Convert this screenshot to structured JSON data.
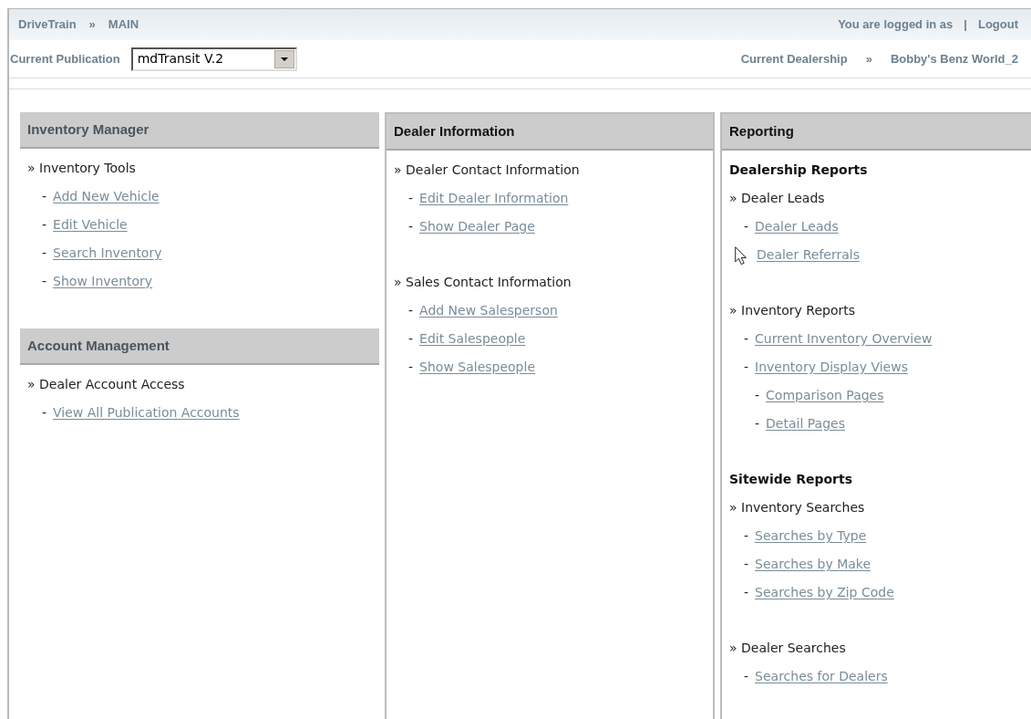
{
  "breadcrumb": [
    "DriveTrain",
    "»",
    "MAIN"
  ],
  "login_text": "You are logged in as",
  "login_separator": "|",
  "logout": "Logout",
  "publication": {
    "label": "Current Publication",
    "value": "mdTransit V.2"
  },
  "dealership": {
    "label": "Current Dealership",
    "separator": "»",
    "value": "Bobby's Benz World_2"
  },
  "columns": [
    {
      "panels": [
        {
          "title": "Inventory Manager",
          "blocks": [
            {
              "kind": "group",
              "label": "» Inventory Tools",
              "links": [
                {
                  "marker": "-",
                  "text": "Add New Vehicle"
                },
                {
                  "marker": "-",
                  "text": "Edit Vehicle"
                },
                {
                  "marker": "-",
                  "text": "Search Inventory"
                },
                {
                  "marker": "-",
                  "text": "Show Inventory"
                }
              ]
            }
          ]
        },
        {
          "title": "Account Management",
          "blocks": [
            {
              "kind": "group",
              "label": "» Dealer Account Access",
              "links": [
                {
                  "marker": "-",
                  "text": "View All Publication Accounts"
                }
              ]
            }
          ]
        }
      ]
    },
    {
      "panels": [
        {
          "title": "Dealer Information",
          "blocks": [
            {
              "kind": "group",
              "label": "» Dealer Contact Information",
              "links": [
                {
                  "marker": "-",
                  "text": "Edit Dealer Information"
                },
                {
                  "marker": "-",
                  "text": "Show Dealer Page"
                }
              ]
            },
            {
              "kind": "group",
              "label": "» Sales Contact Information",
              "links": [
                {
                  "marker": "-",
                  "text": "Add New Salesperson"
                },
                {
                  "marker": "-",
                  "text": "Edit Salespeople"
                },
                {
                  "marker": "-",
                  "text": "Show Salespeople"
                }
              ]
            }
          ]
        }
      ]
    },
    {
      "panels": [
        {
          "title": "Reporting",
          "blocks": [
            {
              "kind": "subheading",
              "label": "Dealership Reports"
            },
            {
              "kind": "group",
              "label": "» Dealer Leads",
              "links": [
                {
                  "marker": "-",
                  "text": "Dealer Leads"
                },
                {
                  "text": "Dealer Referrals"
                }
              ]
            },
            {
              "kind": "group",
              "label": "» Inventory Reports",
              "links": [
                {
                  "marker": "-",
                  "text": "Current Inventory Overview"
                },
                {
                  "marker": "-",
                  "text": "Inventory Display Views",
                  "children": [
                    {
                      "marker": "-",
                      "text": "Comparison Pages"
                    },
                    {
                      "marker": "-",
                      "text": "Detail Pages"
                    }
                  ]
                }
              ]
            },
            {
              "kind": "subheading",
              "label": "Sitewide Reports"
            },
            {
              "kind": "group",
              "label": "» Inventory Searches",
              "links": [
                {
                  "marker": "-",
                  "text": "Searches by Type"
                },
                {
                  "marker": "-",
                  "text": "Searches by Make"
                },
                {
                  "marker": "-",
                  "text": "Searches by Zip Code"
                }
              ]
            },
            {
              "kind": "group",
              "label": "» Dealer Searches",
              "links": [
                {
                  "marker": "-",
                  "text": "Searches for Dealers"
                }
              ]
            }
          ]
        }
      ]
    }
  ]
}
